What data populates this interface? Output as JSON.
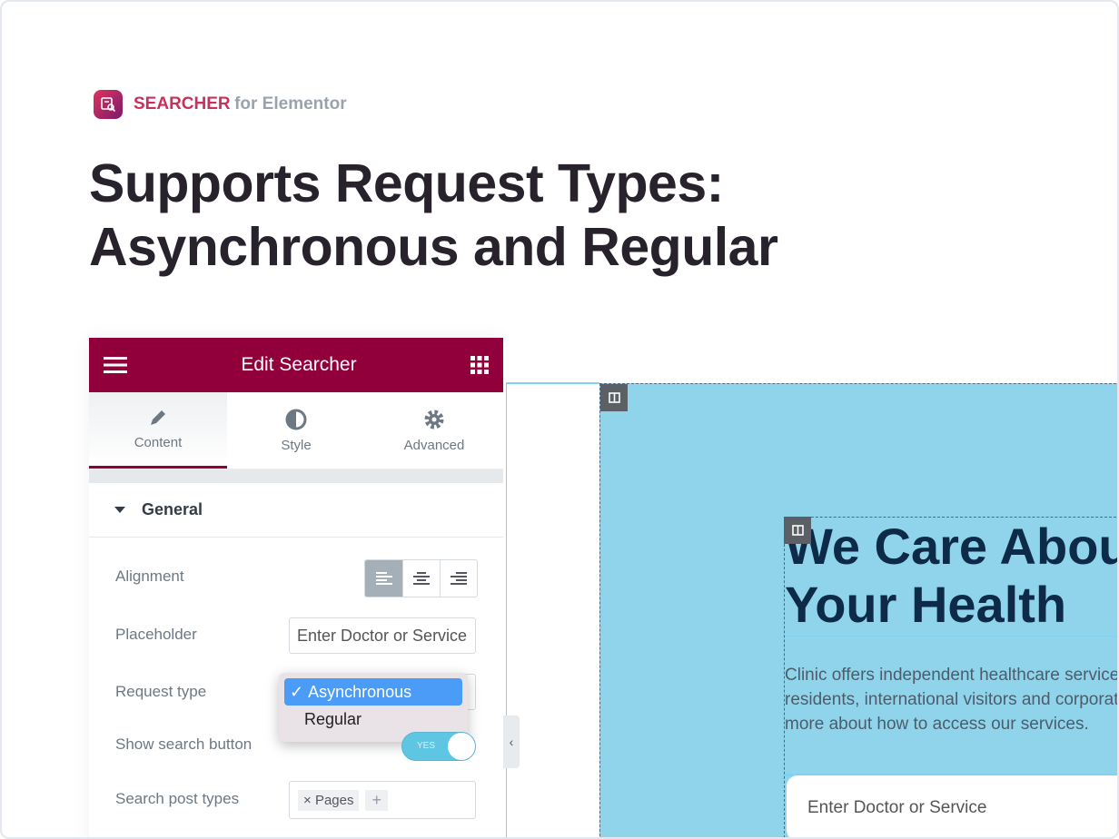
{
  "brand": {
    "name": "SEARCHER",
    "suffix": "for Elementor"
  },
  "headline": {
    "line1": "Supports Request Types:",
    "line2": "Asynchronous and Regular"
  },
  "panel": {
    "title": "Edit Searcher",
    "tabs": [
      {
        "label": "Content",
        "icon": "pencil-icon"
      },
      {
        "label": "Style",
        "icon": "contrast-icon"
      },
      {
        "label": "Advanced",
        "icon": "gear-icon"
      }
    ],
    "section": "General",
    "fields": {
      "alignment": "Alignment",
      "placeholder_label": "Placeholder",
      "placeholder_value": "Enter Doctor or Service",
      "request_type": "Request type",
      "request_options": [
        "Asynchronous",
        "Regular"
      ],
      "selected_option": "Asynchronous",
      "show_search_button": "Show search button",
      "toggle_value": "YES",
      "post_types_label": "Search post types",
      "post_types": [
        "Pages"
      ]
    }
  },
  "preview": {
    "heading_line1": "We Care About",
    "heading_line2": "Your Health",
    "paragraph": [
      "Clinic offers independent healthcare services to U",
      "residents, international visitors and corporates. Fir",
      "more about how to access our services."
    ],
    "search_placeholder": "Enter Doctor or Service"
  },
  "colors": {
    "accent": "#92003b",
    "brand": "#c8315e",
    "preview_bg": "#90d4ec",
    "selected": "#4a9cf6"
  }
}
